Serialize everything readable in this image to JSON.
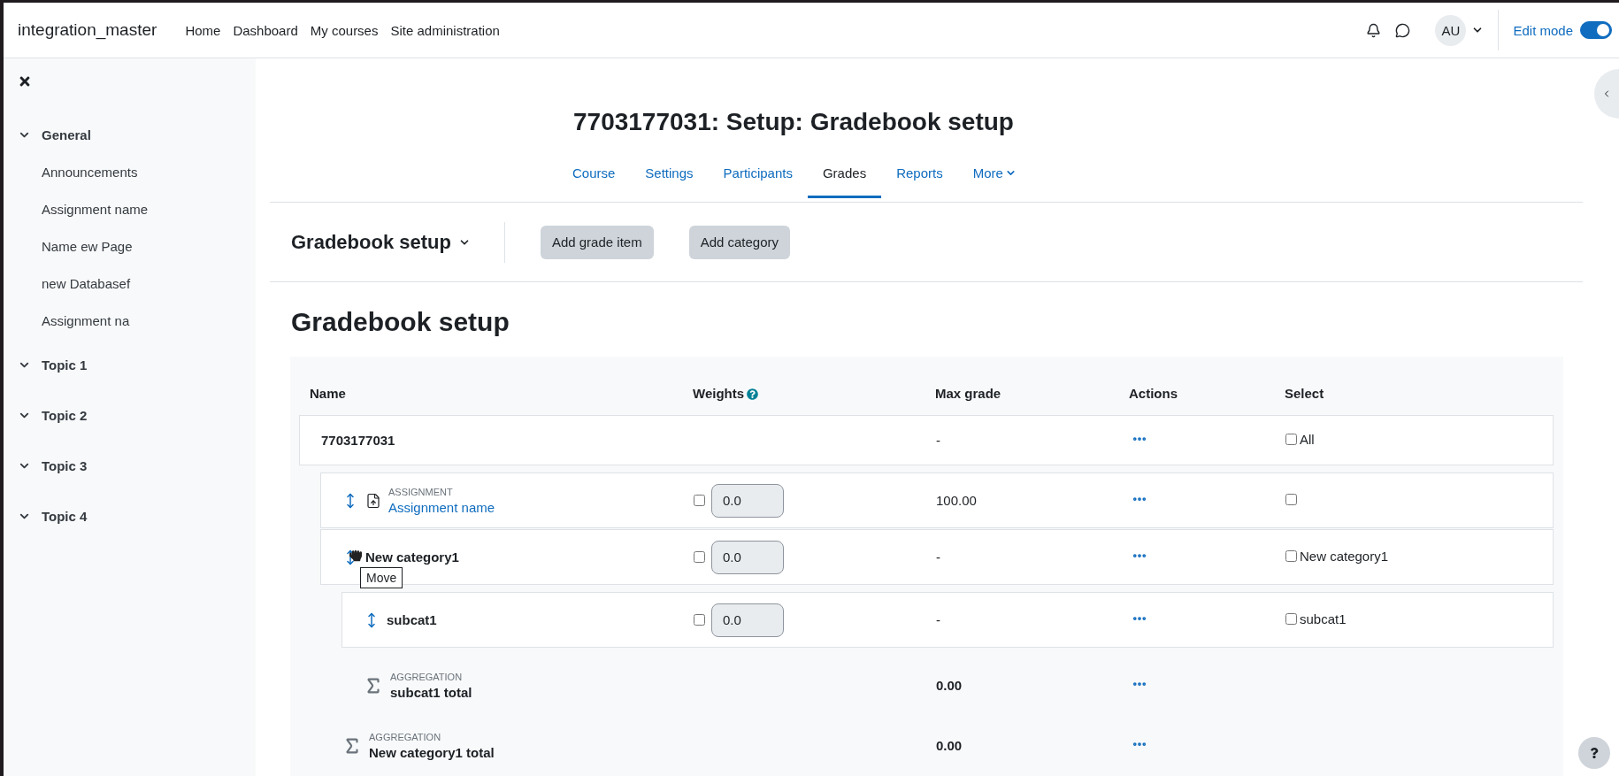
{
  "navbar": {
    "brand": "integration_master",
    "links": [
      "Home",
      "Dashboard",
      "My courses",
      "Site administration"
    ],
    "avatar": "AU",
    "edit_mode": {
      "label": "Edit mode",
      "on": true
    }
  },
  "sidebar": {
    "sections": [
      {
        "title": "General",
        "expanded": true,
        "items": [
          "Announcements",
          "Assignment name",
          "Name ew Page",
          "new Databasef",
          "Assignment na"
        ]
      },
      {
        "title": "Topic 1",
        "expanded": true
      },
      {
        "title": "Topic 2",
        "expanded": true
      },
      {
        "title": "Topic 3",
        "expanded": true
      },
      {
        "title": "Topic 4",
        "expanded": true
      }
    ]
  },
  "header": {
    "title": "7703177031: Setup: Gradebook setup",
    "tabs": [
      {
        "label": "Course",
        "selected": false,
        "dropdown": false
      },
      {
        "label": "Settings",
        "selected": false,
        "dropdown": false
      },
      {
        "label": "Participants",
        "selected": false,
        "dropdown": false
      },
      {
        "label": "Grades",
        "selected": true,
        "dropdown": false
      },
      {
        "label": "Reports",
        "selected": false,
        "dropdown": false
      },
      {
        "label": "More",
        "selected": false,
        "dropdown": true
      }
    ]
  },
  "action_bar": {
    "selector": "Gradebook setup",
    "buttons": [
      "Add grade item",
      "Add category"
    ]
  },
  "heading": "Gradebook setup",
  "table": {
    "columns": [
      "Name",
      "Weights",
      "Max grade",
      "Actions",
      "Select"
    ],
    "rows": [
      {
        "kind": "category",
        "movable": false,
        "name": "7703177031",
        "max_grade": "-",
        "select": {
          "label": "All",
          "checked": false
        },
        "children": [
          {
            "kind": "item",
            "movable": true,
            "type_label": "ASSIGNMENT",
            "name": "Assignment name",
            "weight": {
              "checked": false,
              "value": "0.0",
              "disabled": true
            },
            "max_grade": "100.00",
            "select": {
              "checked": false
            }
          },
          {
            "kind": "category",
            "movable": true,
            "tooltip": "Move",
            "name": "New category1",
            "weight": {
              "checked": false,
              "value": "0.0",
              "disabled": true
            },
            "max_grade": "-",
            "select": {
              "label": "New category1",
              "checked": false
            },
            "children": [
              {
                "kind": "category",
                "movable": true,
                "name": "subcat1",
                "weight": {
                  "checked": false,
                  "value": "0.0",
                  "disabled": true
                },
                "max_grade": "-",
                "select": {
                  "label": "subcat1",
                  "checked": false
                },
                "children": [
                  {
                    "kind": "aggregation",
                    "type_label": "AGGREGATION",
                    "name": "subcat1 total",
                    "max_grade": "0.00"
                  }
                ]
              },
              {
                "kind": "aggregation",
                "type_label": "AGGREGATION",
                "name": "New category1 total",
                "max_grade": "0.00"
              }
            ]
          }
        ]
      }
    ]
  }
}
